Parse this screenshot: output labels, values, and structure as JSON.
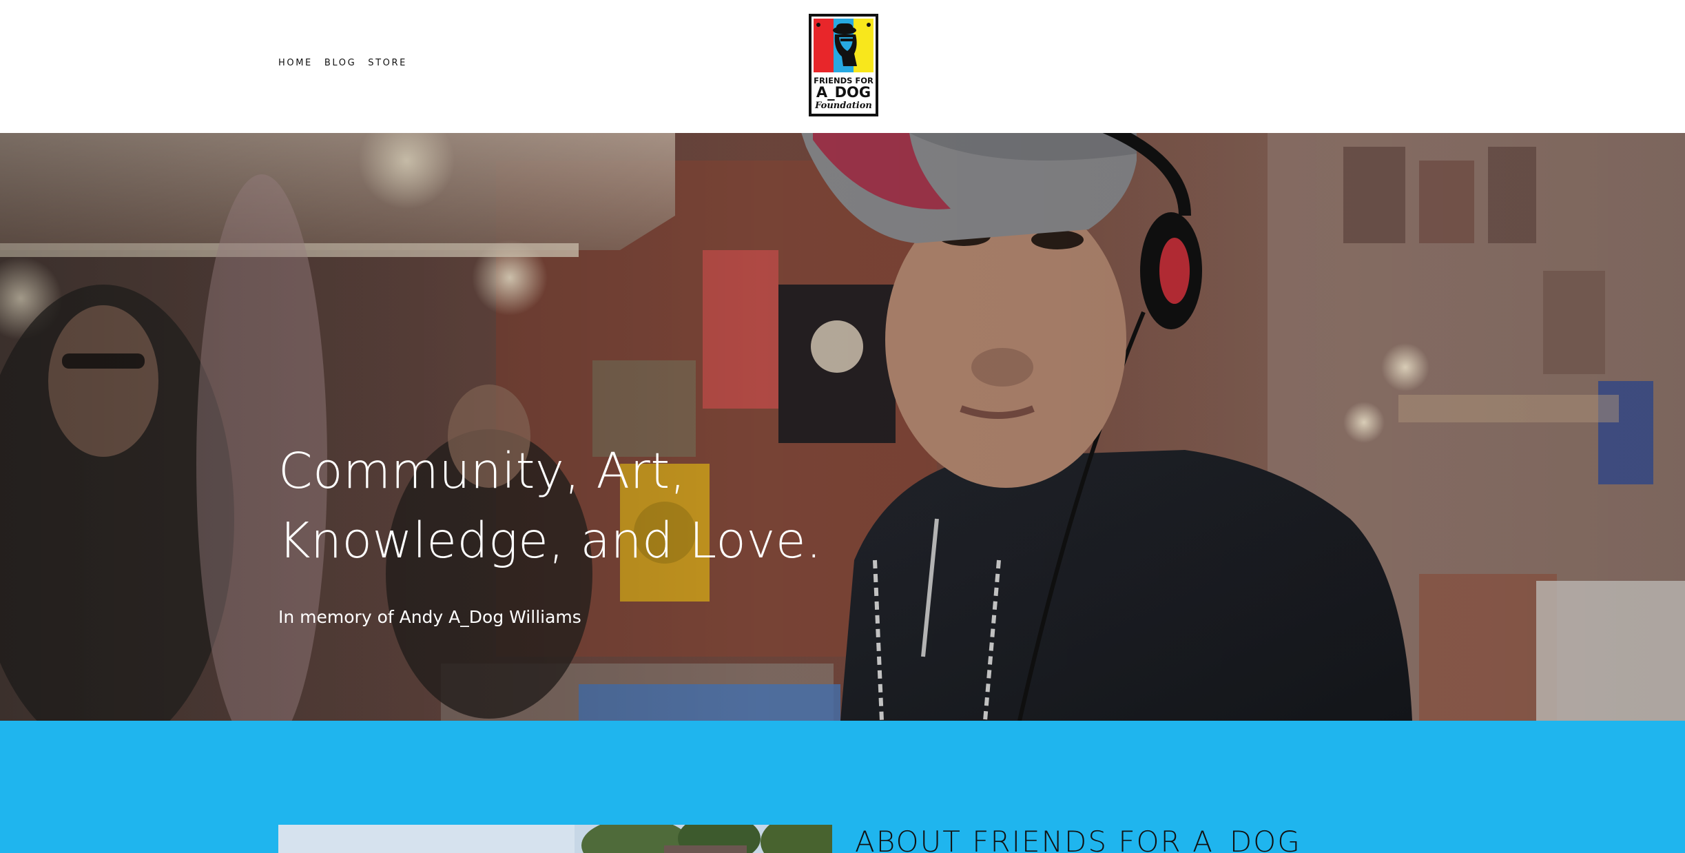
{
  "header": {
    "nav": [
      {
        "label": "HOME"
      },
      {
        "label": "BLOG"
      },
      {
        "label": "STORE"
      }
    ],
    "logo": {
      "lines": [
        "FRIENDS FOR",
        "A_DOG",
        "Foundation"
      ],
      "colors": {
        "red": "#e8262a",
        "blue": "#27a9e1",
        "yellow": "#f8e71c",
        "frame": "#111111"
      }
    }
  },
  "hero": {
    "title_line1": "Community, Art,",
    "title_line2": "Knowledge, and Love.",
    "subtitle": "In memory of Andy A_Dog Williams"
  },
  "about": {
    "heading": "ABOUT FRIENDS FOR A_DOG",
    "background": "#1fb5ee"
  }
}
